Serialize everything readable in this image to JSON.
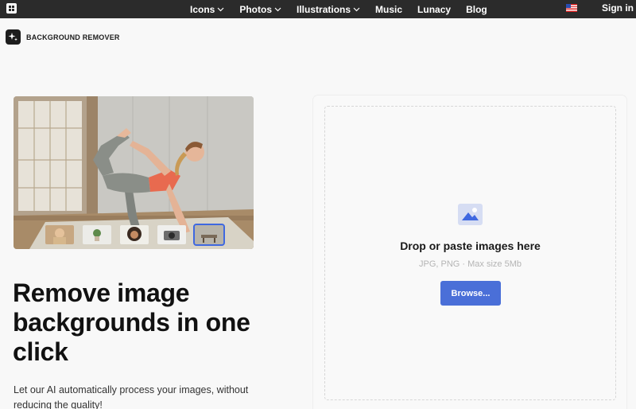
{
  "nav": {
    "items": [
      {
        "label": "Icons",
        "has_dropdown": true
      },
      {
        "label": "Photos",
        "has_dropdown": true
      },
      {
        "label": "Illustrations",
        "has_dropdown": true
      },
      {
        "label": "Music",
        "has_dropdown": false
      },
      {
        "label": "Lunacy",
        "has_dropdown": false
      },
      {
        "label": "Blog",
        "has_dropdown": false
      }
    ],
    "language_flag": "us-flag-icon",
    "signin_label": "Sign in"
  },
  "brand": {
    "title": "BACKGROUND REMOVER",
    "icon": "sparkle-icon"
  },
  "hero": {
    "thumbnails": [
      "woman-portrait",
      "plant",
      "woman-curly-hair",
      "camera",
      "bench"
    ],
    "selected_thumbnail": 4
  },
  "headline": "Remove image backgrounds in one click",
  "subtext": "Let our AI automatically process your images, without reducing the quality!",
  "dropzone": {
    "icon": "image-icon",
    "title": "Drop or paste images here",
    "hint": "JPG, PNG · Max size 5Mb",
    "button_label": "Browse..."
  },
  "colors": {
    "nav_bg": "#2b2b2b",
    "accent": "#4a6fd8",
    "page_bg": "#f8f8f8"
  }
}
